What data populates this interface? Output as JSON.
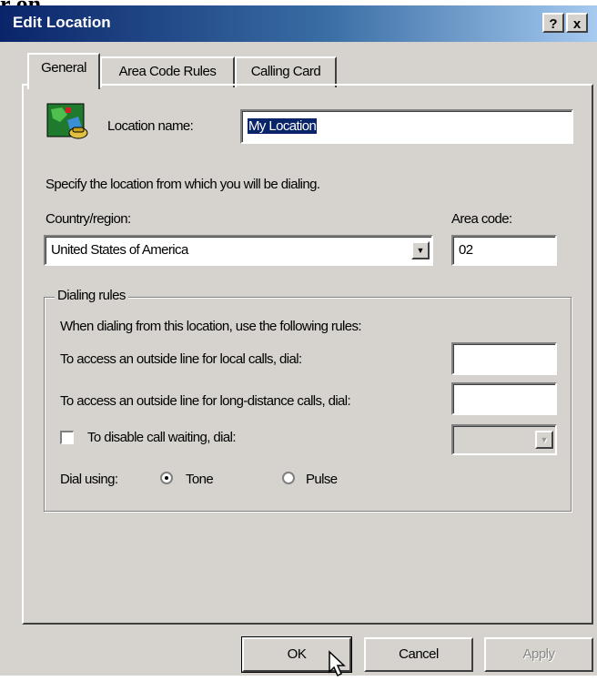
{
  "top_fragment": "r on.",
  "window": {
    "title": "Edit Location",
    "help_btn": "?",
    "close_btn": "x"
  },
  "tabs": [
    "General",
    "Area Code Rules",
    "Calling Card"
  ],
  "general": {
    "location_label": "Location name:",
    "location_value": "My Location",
    "intro": "Specify the location from which you will be dialing.",
    "country_label": "Country/region:",
    "country_value": "United States of America",
    "area_label": "Area code:",
    "area_value": "02"
  },
  "dialing": {
    "legend": "Dialing rules",
    "intro": "When dialing from this location, use the following rules:",
    "local_label": "To access an outside line for local calls, dial:",
    "local_value": "",
    "long_label": "To access an outside line for long-distance calls, dial:",
    "long_value": "",
    "callwait_label": "To disable call waiting, dial:",
    "callwait_checked": false,
    "dial_using_label": "Dial using:",
    "tone_label": "Tone",
    "pulse_label": "Pulse",
    "selected": "Tone"
  },
  "buttons": {
    "ok": "OK",
    "cancel": "Cancel",
    "apply": "Apply"
  },
  "icons": [
    "globe-phone-icon",
    "dropdown-arrow-icon",
    "mouse-pointer-icon"
  ],
  "colors": {
    "titlebar_start": "#0a246a",
    "titlebar_end": "#a6caf0",
    "face": "#d6d3ce",
    "selection": "#0a246a"
  }
}
